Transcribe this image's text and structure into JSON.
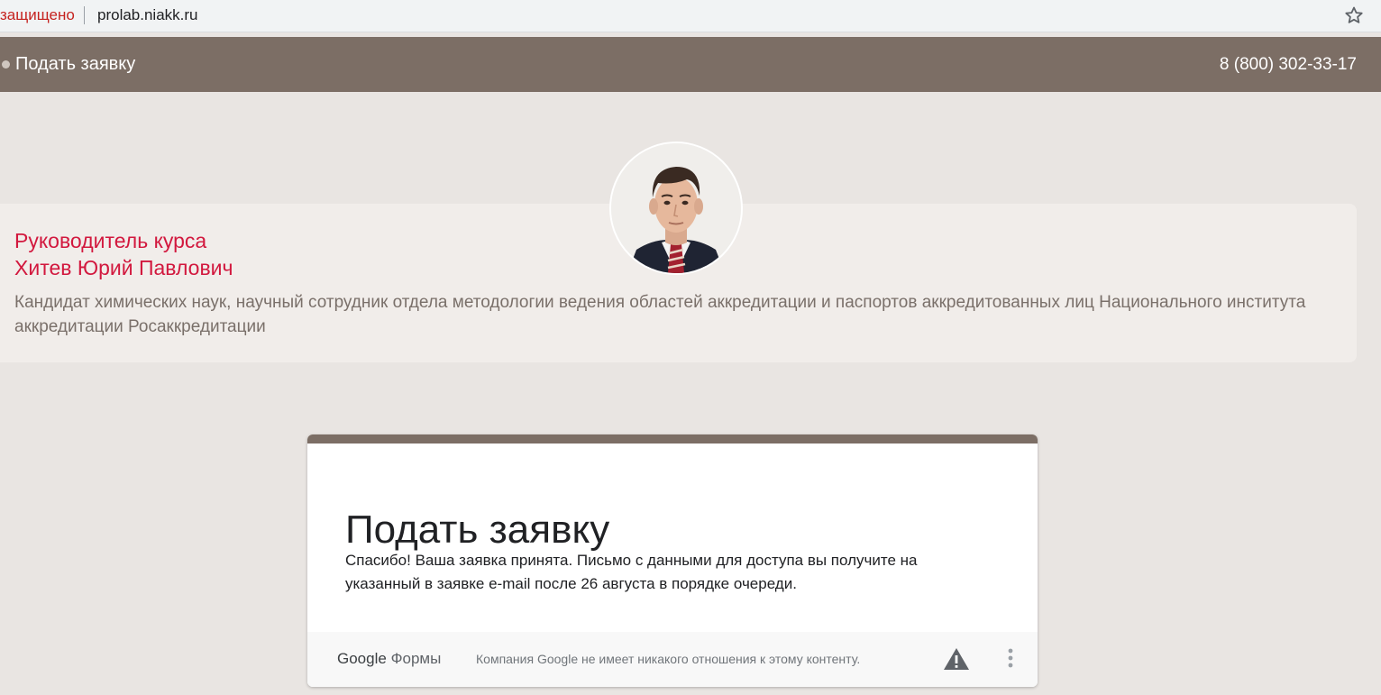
{
  "browser": {
    "security_label": "защищено",
    "url": "prolab.niakk.ru",
    "bookmark_icon": "star-icon"
  },
  "header": {
    "apply_link": "Подать заявку",
    "phone": "8 (800) 302-33-17",
    "background": "#7c6e65"
  },
  "instructor": {
    "role": "Руководитель курса",
    "name": "Хитев Юрий Павлович",
    "bio": "Кандидат химических наук, научный сотрудник отдела методологии ведения областей аккредитации и паспортов аккредитованных лиц Национального института аккредитации Росаккредитации",
    "accent_color": "#d2183e"
  },
  "form": {
    "title": "Подать заявку",
    "message": "Спасибо! Ваша заявка принята. Письмо с данными для доступа вы получите на указанный в заявке e-mail после 26 августа в порядке очереди.",
    "footer": {
      "logo_google": "Google",
      "logo_forms": "Формы",
      "disclaimer": "Компания Google не имеет никакого отношения к этому контенту.",
      "report_icon": "warning-icon",
      "menu_icon": "more-vert-icon"
    }
  }
}
